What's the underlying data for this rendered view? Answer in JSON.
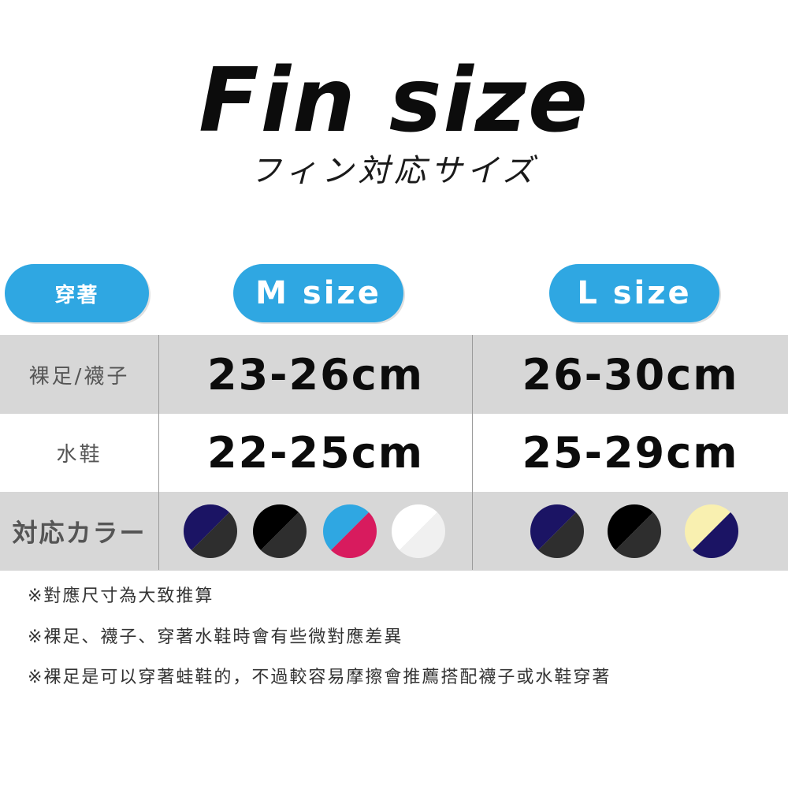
{
  "header": {
    "title": "Fin size",
    "subtitle": "フィン対応サイズ"
  },
  "table": {
    "header_labels": {
      "wear": "穿著",
      "m_size": "M size",
      "l_size": "L size"
    },
    "rows": [
      {
        "label": "裸足/襪子",
        "m": "23-26cm",
        "l": "26-30cm"
      },
      {
        "label": "水鞋",
        "m": "22-25cm",
        "l": "25-29cm"
      },
      {
        "label": "対応カラー"
      }
    ],
    "colors": {
      "m": [
        {
          "name": "navy-black",
          "top": "#1b1464",
          "bottom": "#2e2e2e"
        },
        {
          "name": "black",
          "top": "#000000",
          "bottom": "#2e2e2e"
        },
        {
          "name": "blue-pink",
          "top": "#2fa7e2",
          "bottom": "#d81b5e"
        },
        {
          "name": "white",
          "top": "#ffffff",
          "bottom": "#f0f0f0"
        }
      ],
      "l": [
        {
          "name": "navy-black",
          "top": "#1b1464",
          "bottom": "#2e2e2e"
        },
        {
          "name": "black",
          "top": "#000000",
          "bottom": "#2e2e2e"
        },
        {
          "name": "yellow-navy",
          "top": "#f9f0b0",
          "bottom": "#1b1464"
        }
      ]
    }
  },
  "notes": [
    "※對應尺寸為大致推算",
    "※裸足、襪子、穿著水鞋時會有些微對應差異",
    "※裸足是可以穿著蛙鞋的，不過較容易摩擦會推薦搭配襪子或水鞋穿著"
  ],
  "theme": {
    "accent": "#2fa7e2",
    "row_gray": "#d7d7d7"
  }
}
